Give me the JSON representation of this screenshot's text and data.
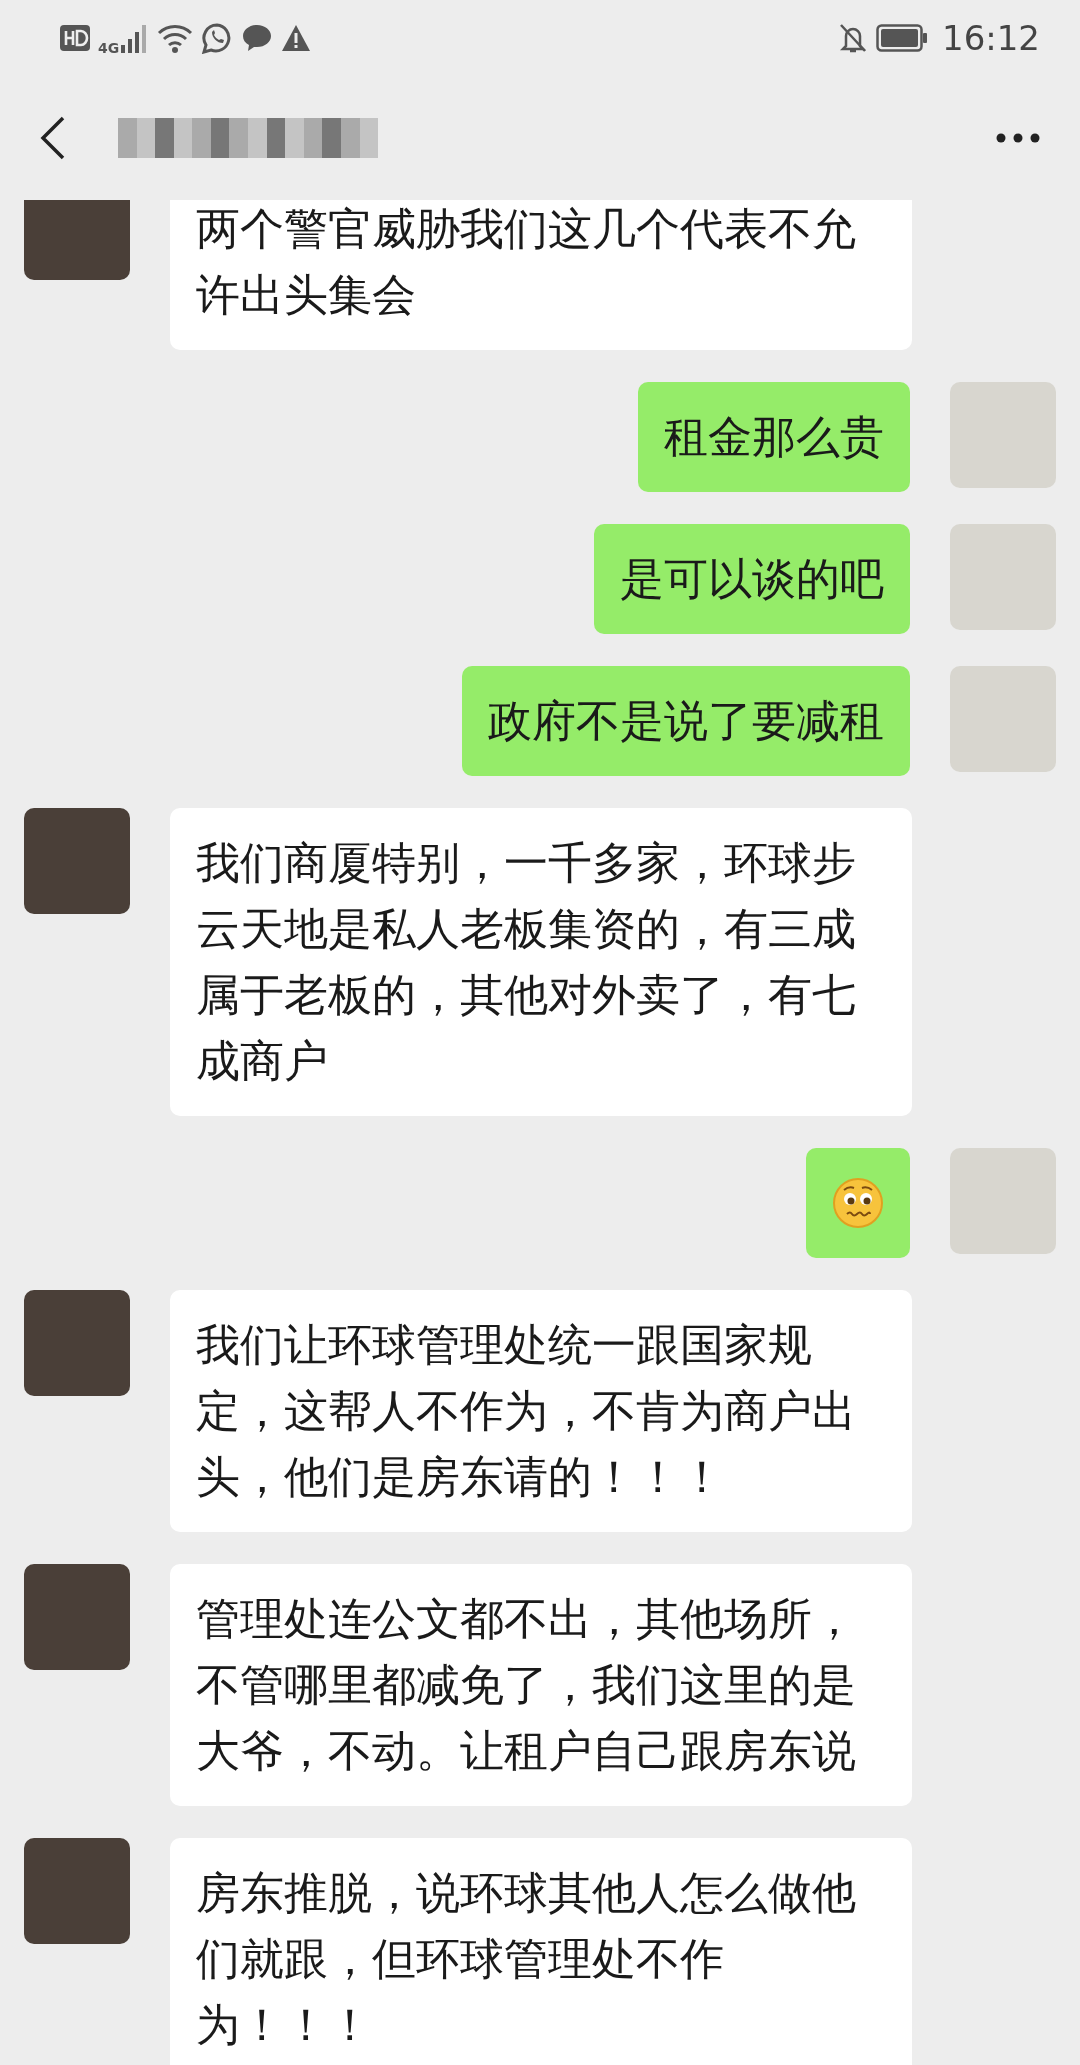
{
  "status_bar": {
    "time": "16:12",
    "network": "4G"
  },
  "messages": [
    {
      "outgoing": false,
      "kind": "text",
      "text": "两个警官威胁我们这几个代表不允许出头集会"
    },
    {
      "outgoing": true,
      "kind": "text",
      "text": "租金那么贵"
    },
    {
      "outgoing": true,
      "kind": "text",
      "text": "是可以谈的吧"
    },
    {
      "outgoing": true,
      "kind": "text",
      "text": "政府不是说了要减租"
    },
    {
      "outgoing": false,
      "kind": "text",
      "text": "我们商厦特别，一千多家，环球步云天地是私人老板集资的，有三成属于老板的，其他对外卖了，有七成商户"
    },
    {
      "outgoing": true,
      "kind": "emoji"
    },
    {
      "outgoing": false,
      "kind": "text",
      "text": "我们让环球管理处统一跟国家规定，这帮人不作为，不肯为商户出头，他们是房东请的！！！"
    },
    {
      "outgoing": false,
      "kind": "text",
      "text": "管理处连公文都不出，其他场所，不管哪里都减免了，我们这里的是大爷，不动。让租户自己跟房东说"
    },
    {
      "outgoing": false,
      "kind": "text",
      "text": "房东推脱，说环球其他人怎么做他们就跟，但环球管理处不作为！！！"
    }
  ]
}
